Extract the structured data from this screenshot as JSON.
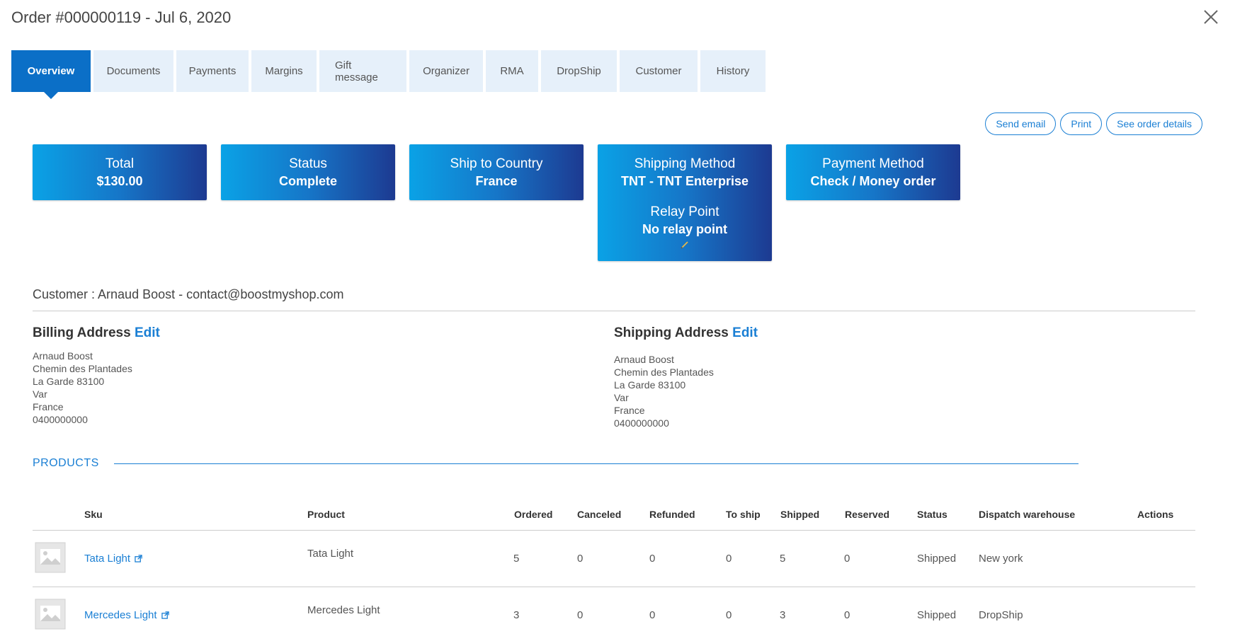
{
  "header": {
    "title": "Order #000000119 - Jul 6, 2020",
    "close_icon": "close-icon"
  },
  "tabs": [
    {
      "label": "Overview",
      "active": true
    },
    {
      "label": "Documents"
    },
    {
      "label": "Payments"
    },
    {
      "label": "Margins"
    },
    {
      "label": "Gift message"
    },
    {
      "label": "Organizer"
    },
    {
      "label": "RMA"
    },
    {
      "label": "DropShip"
    },
    {
      "label": "Customer"
    },
    {
      "label": "History"
    }
  ],
  "actions": {
    "send_email": "Send email",
    "print": "Print",
    "see_details": "See order details"
  },
  "cards": {
    "total": {
      "label": "Total",
      "value": "$130.00"
    },
    "status": {
      "label": "Status",
      "value": "Complete"
    },
    "country": {
      "label": "Ship to Country",
      "value": "France"
    },
    "shipping": {
      "label": "Shipping Method",
      "value": "TNT - TNT Enterprise",
      "relay_label": "Relay Point",
      "relay_value": "No relay point"
    },
    "payment": {
      "label": "Payment Method",
      "value": "Check / Money order"
    }
  },
  "customer": {
    "text": "Customer : Arnaud Boost - contact@boostmyshop.com"
  },
  "billing": {
    "title": "Billing Address",
    "edit": "Edit",
    "lines": [
      "Arnaud Boost",
      "Chemin des Plantades",
      "La Garde 83100",
      "Var",
      "France",
      "0400000000"
    ]
  },
  "shipping_address": {
    "title": "Shipping Address",
    "edit": "Edit",
    "lines": [
      "Arnaud Boost",
      "Chemin des Plantades",
      "La Garde 83100",
      "Var",
      "France",
      "0400000000"
    ]
  },
  "products": {
    "title": "PRODUCTS",
    "columns": [
      "Sku",
      "Product",
      "Ordered",
      "Canceled",
      "Refunded",
      "To ship",
      "Shipped",
      "Reserved",
      "Status",
      "Dispatch warehouse",
      "Actions"
    ],
    "rows": [
      {
        "sku": "Tata Light",
        "product": "Tata Light",
        "ordered": "5",
        "canceled": "0",
        "refunded": "0",
        "to_ship": "0",
        "shipped": "5",
        "reserved": "0",
        "status": "Shipped",
        "warehouse": "New york"
      },
      {
        "sku": "Mercedes Light",
        "product": "Mercedes Light",
        "ordered": "3",
        "canceled": "0",
        "refunded": "0",
        "to_ship": "0",
        "shipped": "3",
        "reserved": "0",
        "status": "Shipped",
        "warehouse": "DropShip"
      }
    ]
  },
  "colors": {
    "accent": "#1a7fd4",
    "tab_active": "#0b6fc7",
    "tab_bg": "#e6f0fa"
  }
}
